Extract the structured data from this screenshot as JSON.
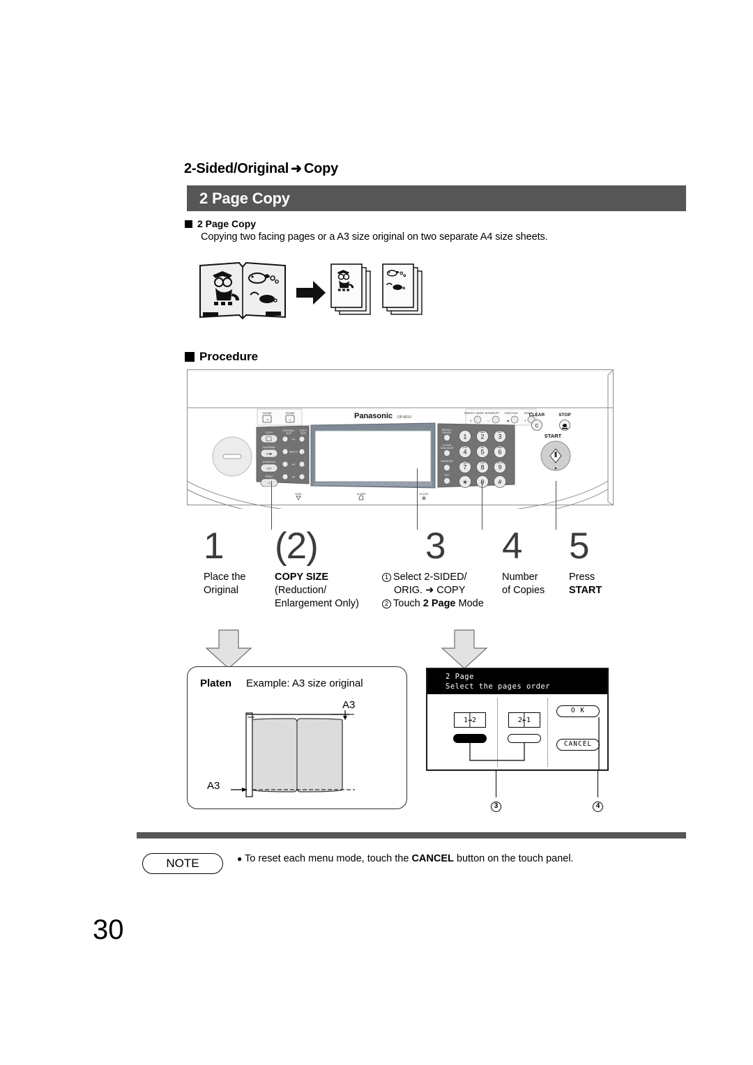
{
  "document": {
    "breadcrumb": "2-Sided/Original",
    "breadcrumb_arrow": "➜",
    "breadcrumb_tail": "Copy",
    "section_title": "2 Page Copy",
    "page_number": "30"
  },
  "subsection": {
    "heading": "2 Page Copy",
    "description": "Copying two facing pages or a A3 size original on two separate A4 size sheets."
  },
  "procedure": {
    "heading": "Procedure",
    "steps": [
      {
        "number": "1",
        "lines": [
          "Place the",
          "Original"
        ]
      },
      {
        "number": "(2)",
        "lines": [
          "COPY SIZE",
          "(Reduction/",
          "Enlargement Only)"
        ],
        "bold_first": true
      },
      {
        "number": "3",
        "marker1": "1",
        "line1": "Select 2-SIDED/",
        "line2": "ORIG. ➜ COPY",
        "marker2": "2",
        "line3_pre": "Touch ",
        "line3_bold": "2 Page",
        "line3_post": " Mode"
      },
      {
        "number": "4",
        "lines": [
          "Number",
          "of Copies"
        ]
      },
      {
        "number": "5",
        "lines": [
          "Press",
          "START"
        ],
        "bold_last": true
      }
    ]
  },
  "copier_panel": {
    "brand": "Panasonic",
    "model": "DP-6010",
    "status_leds": [
      {
        "label": "ONLINE",
        "icon": "fax-online-icon"
      },
      {
        "label": "ONLINE",
        "icon": "printer-online-icon"
      }
    ],
    "mode_keys": [
      "COPY",
      "FAX/EMAIL",
      "SCAN/FILE",
      "PRINT"
    ],
    "size_columns": [
      "ORIGINAL SIZE",
      "COPY SIZE"
    ],
    "size_rows": [
      "A3",
      "B4/FLS",
      "A4",
      "A5"
    ],
    "function_keys": [
      "ENERGY SAVER",
      "INTERRUPT",
      "FUNCTION",
      "RESET"
    ],
    "side_keys": [
      "REDIAL/ PAUSE",
      "FLASH/ SUB-ADDR",
      "MONITOR",
      "SET"
    ],
    "clear_label": "CLEAR",
    "clear_glyph": "C",
    "stop_label": "STOP",
    "start_label": "START",
    "keypad": [
      "1",
      "2",
      "3",
      "4",
      "5",
      "6",
      "7",
      "8",
      "9",
      "∗",
      "0",
      "#"
    ],
    "keypad_sub": [
      "",
      "ABC",
      "DEF",
      "GHI",
      "JKL",
      "MNO",
      "PQRS",
      "TUV",
      "WXYZ",
      "",
      "",
      ""
    ],
    "indicator_lights": [
      "DATA",
      "ALARM",
      "ACTIVE"
    ]
  },
  "platen_panel": {
    "label": "Platen",
    "example": "Example: A3 size original",
    "size_top": "A3",
    "size_left": "A3"
  },
  "lcd_panel": {
    "title_line1": "2 Page",
    "title_line2": "Select the pages order",
    "option_left": "1→2",
    "option_right": "2←1",
    "ok_label": "O K",
    "cancel_label": "CANCEL",
    "selected": "left",
    "callouts": [
      "3",
      "4"
    ]
  },
  "note": {
    "label": "NOTE",
    "bullet": "●",
    "text_pre": "To reset each menu mode, touch the ",
    "text_bold": "CANCEL",
    "text_post": " button on the touch panel."
  },
  "colors": {
    "band": "#565656",
    "rule": "#565656",
    "step_number": "#3c3c3c",
    "panel_dark": "#6b6b6b",
    "panel_light": "#d9d9d9"
  }
}
